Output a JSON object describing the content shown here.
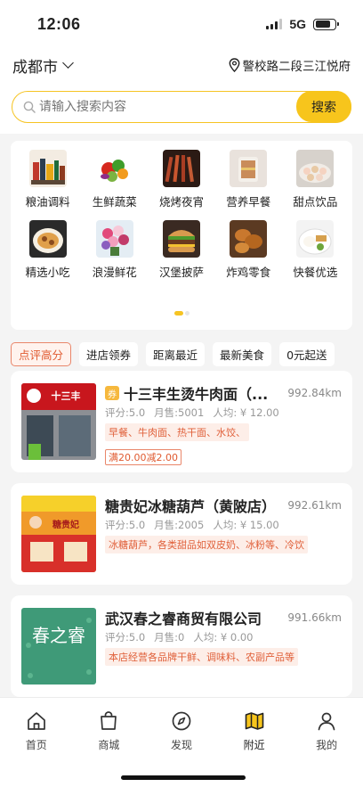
{
  "status_bar": {
    "time": "12:06",
    "network": "5G"
  },
  "location": {
    "city": "成都市",
    "address": "警校路二段三江悦府"
  },
  "search": {
    "placeholder": "请输入搜索内容",
    "button": "搜索"
  },
  "categories": [
    {
      "label": "粮油调料",
      "icon": "grocery-icon"
    },
    {
      "label": "生鲜蔬菜",
      "icon": "vegetables-icon"
    },
    {
      "label": "烧烤夜宵",
      "icon": "bbq-icon"
    },
    {
      "label": "营养早餐",
      "icon": "breakfast-icon"
    },
    {
      "label": "甜点饮品",
      "icon": "dessert-icon"
    },
    {
      "label": "精选小吃",
      "icon": "snack-icon"
    },
    {
      "label": "浪漫鲜花",
      "icon": "flowers-icon"
    },
    {
      "label": "汉堡披萨",
      "icon": "burger-icon"
    },
    {
      "label": "炸鸡零食",
      "icon": "fried-chicken-icon"
    },
    {
      "label": "快餐优选",
      "icon": "fast-food-icon"
    }
  ],
  "filters": [
    "点评高分",
    "进店领券",
    "距离最近",
    "最新美食",
    "0元起送"
  ],
  "shops": [
    {
      "name": "十三丰生烫牛肉面（...",
      "distance": "992.84km",
      "rating": "评分:5.0",
      "monthly_sales": "月售:5001",
      "per_person": "人均: ¥ 12.00",
      "tags": "早餐、牛肉面、热干面、水饺、",
      "coupon": "满20.00减2.00",
      "sign_text": "十三丰"
    },
    {
      "name": "糖贵妃冰糖葫芦（黄陂店）",
      "distance": "992.61km",
      "rating": "评分:5.0",
      "monthly_sales": "月售:2005",
      "per_person": "人均: ¥ 15.00",
      "tags": "冰糖葫芦，各类甜品如双皮奶、冰粉等、冷饮",
      "coupon": "",
      "sign_text": "糖贵妃"
    },
    {
      "name": "武汉春之睿商贸有限公司",
      "distance": "991.66km",
      "rating": "评分:5.0",
      "monthly_sales": "月售:0",
      "per_person": "人均: ¥ 0.00",
      "tags": "本店经营各品牌干鲜、调味料、农副产品等",
      "coupon": "",
      "sign_text": "春之睿"
    }
  ],
  "tab_bar": [
    {
      "label": "首页",
      "icon": "home-icon"
    },
    {
      "label": "商城",
      "icon": "shopping-bag-icon"
    },
    {
      "label": "发现",
      "icon": "compass-icon"
    },
    {
      "label": "附近",
      "icon": "map-icon"
    },
    {
      "label": "我的",
      "icon": "user-icon"
    }
  ],
  "colors": {
    "accent": "#f7c51c",
    "tag_text": "#e0603a",
    "tag_bg": "#fdeee8"
  }
}
